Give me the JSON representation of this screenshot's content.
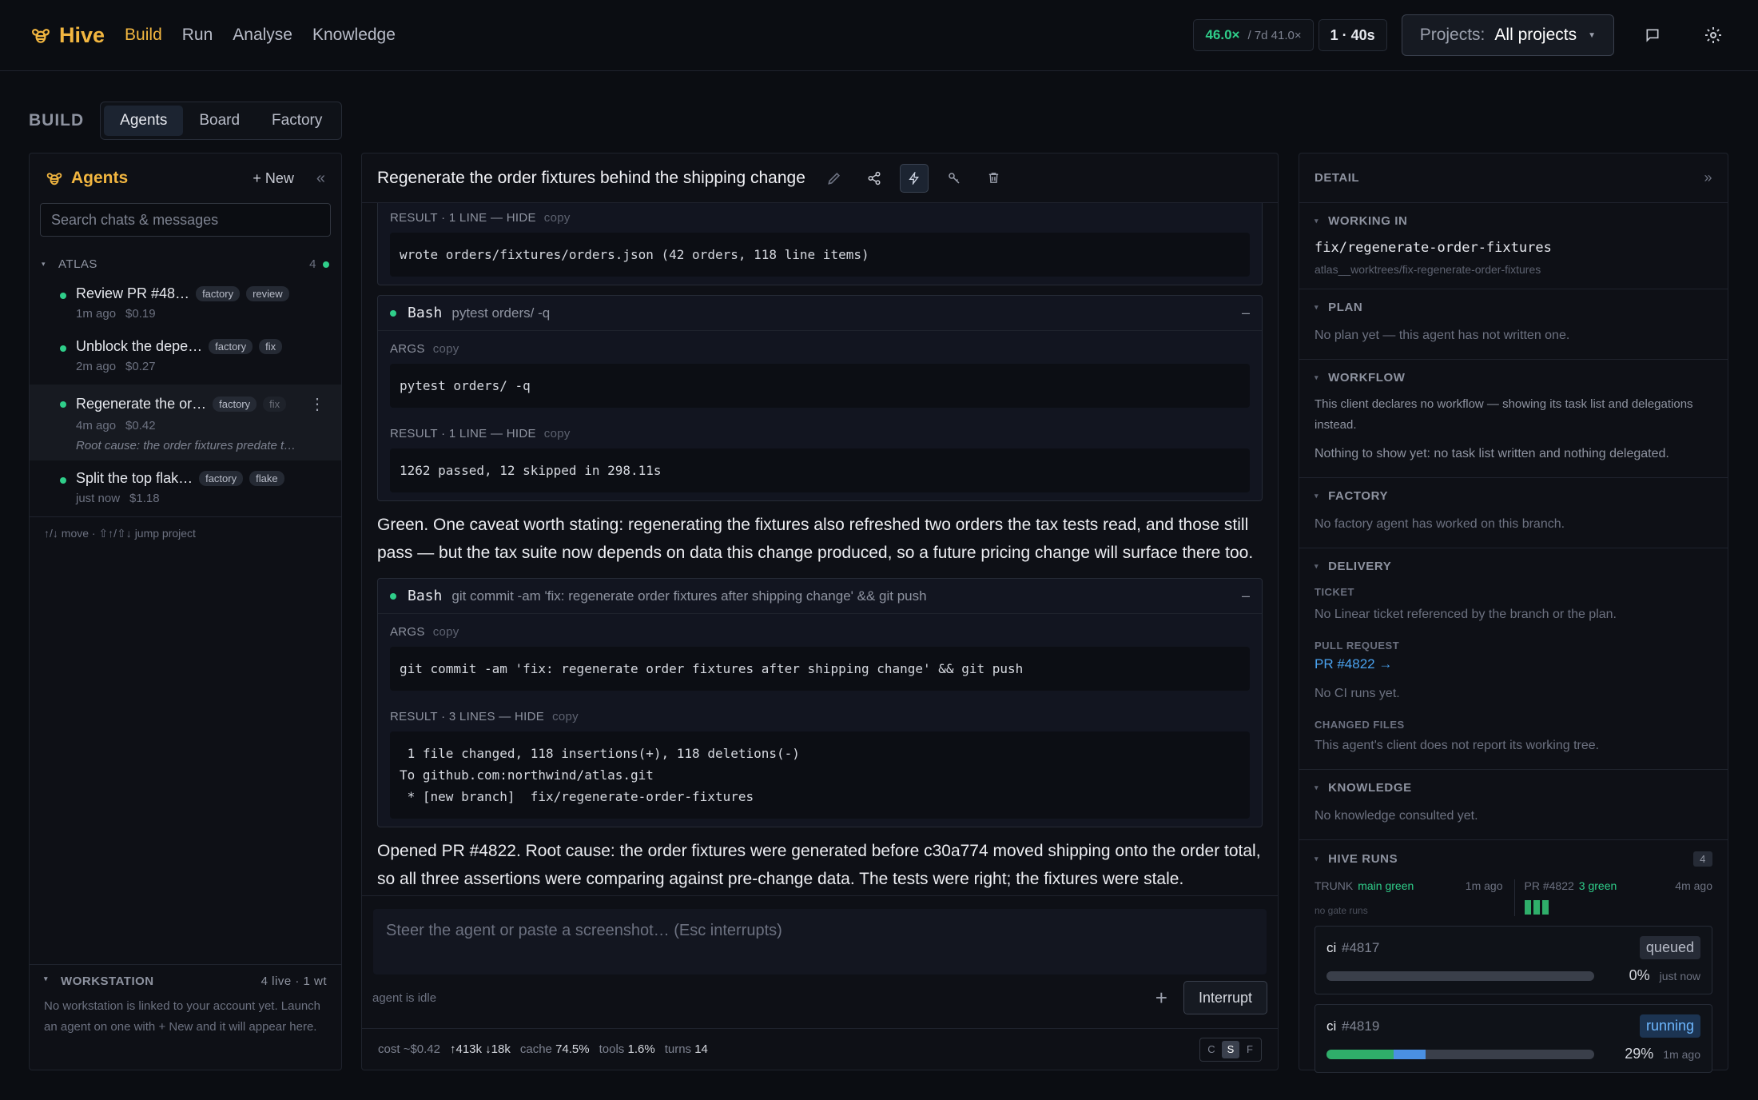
{
  "app": {
    "name": "Hive"
  },
  "nav": [
    "Build",
    "Run",
    "Analyse",
    "Knowledge"
  ],
  "metrics": {
    "ratio": "46.0×",
    "ratio_7d": "/ 7d 41.0×",
    "timer": "1 · 40s"
  },
  "projects": {
    "label": "Projects:",
    "value": "All projects"
  },
  "build": {
    "label": "BUILD",
    "tabs": [
      "Agents",
      "Board",
      "Factory"
    ]
  },
  "agents": {
    "title": "Agents",
    "new_label": "+ New",
    "collapse": "«",
    "search_placeholder": "Search chats & messages",
    "group": {
      "name": "ATLAS",
      "count": "4"
    },
    "items": [
      {
        "title": "Review PR #48…",
        "tags": [
          "factory",
          "review"
        ],
        "time": "1m ago",
        "cost": "$0.19"
      },
      {
        "title": "Unblock the depe…",
        "tags": [
          "factory",
          "fix"
        ],
        "time": "2m ago",
        "cost": "$0.27"
      },
      {
        "title": "Regenerate the or…",
        "tags": [
          "factory",
          "fix"
        ],
        "time": "4m ago",
        "cost": "$0.42",
        "note": "Root cause: the order fixtures predate t…"
      },
      {
        "title": "Split the top flak…",
        "tags": [
          "factory",
          "flake"
        ],
        "time": "just now",
        "cost": "$1.18"
      }
    ],
    "shortcuts": "↑/↓ move · ⇧↑/⇧↓ jump project",
    "workstation": {
      "title": "WORKSTATION",
      "meta": "4 live · 1 wt",
      "text": "No workstation is linked to your account yet. Launch an agent on one with + New and it will appear here."
    }
  },
  "conversation": {
    "title": "Regenerate the order fixtures behind the shipping change",
    "top_result": {
      "label": "RESULT · 1 LINE — HIDE",
      "copy": "copy",
      "output": "wrote orders/fixtures/orders.json (42 orders, 118 line items)"
    },
    "tool1": {
      "name": "Bash",
      "cmd": "pytest orders/ -q",
      "args_label": "ARGS",
      "copy": "copy",
      "args": "pytest orders/ -q",
      "result_label": "RESULT · 1 LINE — HIDE",
      "output": "1262 passed, 12 skipped in 298.11s"
    },
    "msg1": "Green. One caveat worth stating: regenerating the fixtures also refreshed two orders the tax tests read, and those still pass — but the tax suite now depends on data this change produced, so a future pricing change will surface there too.",
    "tool2": {
      "name": "Bash",
      "cmd": "git commit -am 'fix: regenerate order fixtures after shipping change' && git push",
      "args_label": "ARGS",
      "copy": "copy",
      "args": "git commit -am 'fix: regenerate order fixtures after shipping change' && git push",
      "result_label": "RESULT · 3 LINES — HIDE",
      "output": " 1 file changed, 118 insertions(+), 118 deletions(-)\nTo github.com:northwind/atlas.git\n * [new branch]  fix/regenerate-order-fixtures"
    },
    "msg2": "Opened PR #4822. Root cause: the order fixtures were generated before c30a774 moved shipping onto the order total, so all three assertions were comparing against pre-change data. The tests were right; the fixtures were stale.",
    "composer_placeholder": "Steer the agent or paste a screenshot…  (Esc interrupts)",
    "status": "agent is idle",
    "interrupt": "Interrupt",
    "footer": {
      "cost_label": "cost",
      "cost": "~$0.42",
      "tokens": "↑413k ↓18k",
      "cache_label": "cache",
      "cache": "74.5%",
      "tools_label": "tools",
      "tools": "1.6%",
      "turns_label": "turns",
      "turns": "14",
      "modes": [
        "C",
        "S",
        "F"
      ]
    }
  },
  "detail": {
    "title": "DETAIL",
    "expand": "»",
    "working_in": {
      "title": "WORKING IN",
      "branch": "fix/regenerate-order-fixtures",
      "path": "atlas__worktrees/fix-regenerate-order-fixtures"
    },
    "plan": {
      "title": "PLAN",
      "text": "No plan yet — this agent has not written one."
    },
    "workflow": {
      "title": "WORKFLOW",
      "text": "This client declares no workflow — showing its task list and delegations instead.",
      "text2": "Nothing to show yet: no task list written and nothing delegated."
    },
    "factory": {
      "title": "FACTORY",
      "text": "No factory agent has worked on this branch."
    },
    "delivery": {
      "title": "DELIVERY",
      "ticket_label": "TICKET",
      "ticket": "No Linear ticket referenced by the branch or the plan.",
      "pr_label": "PULL REQUEST",
      "pr": "PR #4822 →",
      "ci": "No CI runs yet.",
      "files_label": "CHANGED FILES",
      "files": "This agent's client does not report its working tree."
    },
    "knowledge": {
      "title": "KNOWLEDGE",
      "text": "No knowledge consulted yet."
    },
    "hive_runs": {
      "title": "HIVE RUNS",
      "count": "4",
      "trunk": {
        "label": "TRUNK",
        "status": "main green",
        "time": "1m ago",
        "note": "no gate runs"
      },
      "pr": {
        "label": "PR #4822",
        "status": "3 green",
        "time": "4m ago"
      },
      "jobs": [
        {
          "name": "ci",
          "num": "#4817",
          "status": "queued",
          "percent": "0%",
          "time": "just now",
          "pass": 0,
          "running": 0
        },
        {
          "name": "ci",
          "num": "#4819",
          "status": "running",
          "percent": "29%",
          "time": "1m ago",
          "pass": 0.25,
          "running": 0.12
        }
      ]
    }
  }
}
